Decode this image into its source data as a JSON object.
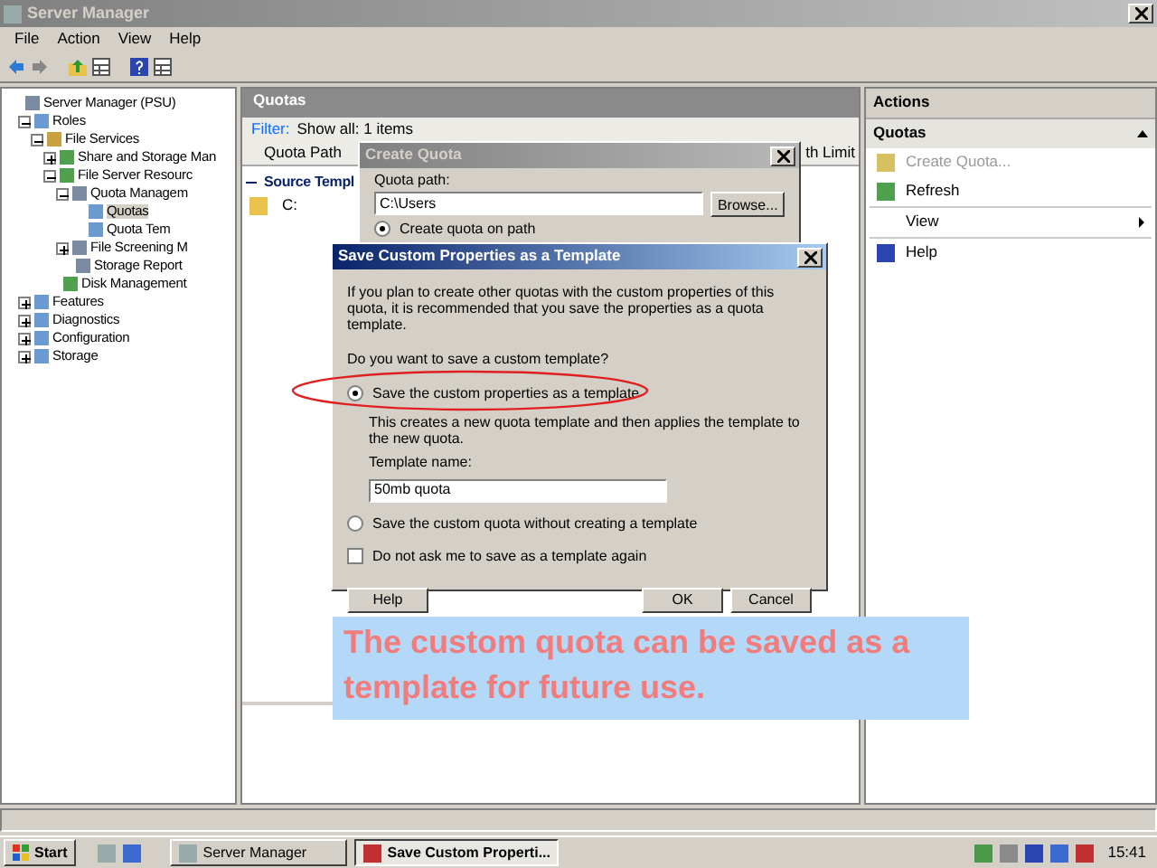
{
  "window": {
    "title": "Server Manager"
  },
  "menu": [
    "File",
    "Action",
    "View",
    "Help"
  ],
  "tree": [
    {
      "label": "Server Manager (PSU)",
      "selected": false,
      "children": [
        {
          "label": "Roles",
          "expanded": true,
          "selected": false,
          "children": [
            {
              "label": "File Services",
              "expanded": true,
              "selected": false,
              "children": [
                {
                  "label": "Share and Storage Man",
                  "expanded": false,
                  "selected": false
                },
                {
                  "label": "File Server Resourc",
                  "expanded": true,
                  "selected": false,
                  "children": [
                    {
                      "label": "Quota Managem",
                      "expanded": true,
                      "selected": false,
                      "children": [
                        {
                          "label": "Quotas",
                          "selected": true
                        },
                        {
                          "label": "Quota Tem",
                          "selected": false
                        }
                      ]
                    },
                    {
                      "label": "File Screening M",
                      "expanded": false,
                      "selected": false
                    },
                    {
                      "label": "Storage Report",
                      "selected": false
                    }
                  ]
                },
                {
                  "label": "Disk Management",
                  "selected": false
                }
              ]
            }
          ]
        },
        {
          "label": "Features",
          "expanded": false,
          "selected": false
        },
        {
          "label": "Diagnostics",
          "expanded": false,
          "selected": false
        },
        {
          "label": "Configuration",
          "expanded": false,
          "selected": false
        },
        {
          "label": "Storage",
          "expanded": false,
          "selected": false
        }
      ]
    }
  ],
  "center": {
    "title": "Quotas",
    "filter_label": "Filter:",
    "filter_value": "Show all: 1 items",
    "columns": [
      "Quota Path",
      "th Limit"
    ],
    "groups": [
      {
        "label": "Source Templ",
        "expanded": true,
        "rows": [
          {
            "path": "C:"
          }
        ]
      }
    ]
  },
  "create_quota": {
    "title": "Create Quota",
    "path_label": "Quota path:",
    "path_value": "C:\\Users",
    "browse": "Browse...",
    "option": {
      "label": "Create quota on path",
      "selected": true
    }
  },
  "save_template": {
    "title": "Save Custom Properties as a Template",
    "intro": "If you plan to create other quotas with the custom properties of this quota, it is recommended that you save the properties as a quota template.",
    "question": "Do you want to save a custom template?",
    "options": [
      {
        "label": "Save the custom properties as a template",
        "selected": true,
        "note": "This creates a new quota template and then applies the template to the new quota.",
        "field_label": "Template name:",
        "field_value": "50mb quota"
      },
      {
        "label": "Save the custom quota without creating a template",
        "selected": false
      }
    ],
    "dont_ask": {
      "label": "Do not ask me to save as a template again",
      "checked": false
    },
    "buttons": [
      {
        "label": "Help",
        "kind": "left"
      },
      {
        "label": "OK",
        "kind": "right"
      },
      {
        "label": "Cancel",
        "kind": "right"
      }
    ]
  },
  "actions": {
    "title": "Actions",
    "section": "Quotas",
    "items": [
      {
        "label": "Create Quota...",
        "disabled": true,
        "submenu": false
      },
      {
        "label": "Refresh",
        "disabled": false,
        "submenu": false
      },
      {
        "label": "View",
        "disabled": false,
        "submenu": true
      },
      {
        "label": "Help",
        "disabled": false,
        "submenu": false
      }
    ]
  },
  "callout": {
    "text": "The custom quota can be saved as a template for future use."
  },
  "taskbar": {
    "start": "Start",
    "tasks": [
      {
        "label": "Server Manager",
        "selected": false
      },
      {
        "label": "Save Custom Properti...",
        "selected": true
      }
    ],
    "clock": "15:41"
  }
}
